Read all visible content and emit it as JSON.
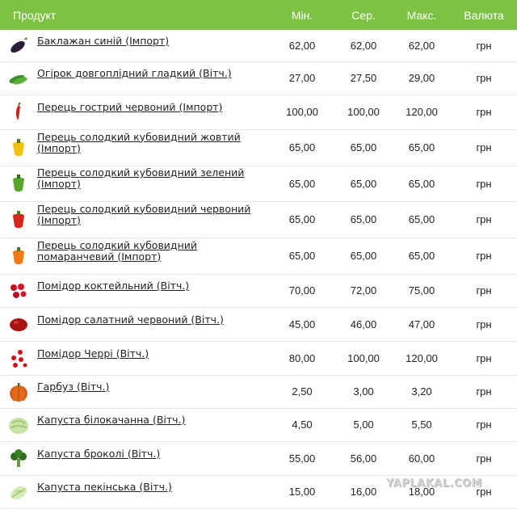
{
  "header": {
    "product": "Продукт",
    "min": "Мін.",
    "avg": "Сер.",
    "max": "Макс.",
    "currency": "Валюта"
  },
  "colors": {
    "header_bg": "#7dc242",
    "header_text": "#ffffff"
  },
  "rows": [
    {
      "icon": "eggplant-icon",
      "name": "Баклажан синій (Імпорт)",
      "min": "62,00",
      "avg": "62,00",
      "max": "62,00",
      "cur": "грн"
    },
    {
      "icon": "cucumber-icon",
      "name": "Огірок довгоплідний гладкий (Вітч.)",
      "min": "27,00",
      "avg": "27,50",
      "max": "29,00",
      "cur": "грн"
    },
    {
      "icon": "chili-pepper-icon",
      "name": "Перець гострий червоний (Імпорт)",
      "min": "100,00",
      "avg": "100,00",
      "max": "120,00",
      "cur": "грн"
    },
    {
      "icon": "yellow-pepper-icon",
      "name": "Перець солодкий кубовидний жовтий (Імпорт)",
      "min": "65,00",
      "avg": "65,00",
      "max": "65,00",
      "cur": "грн"
    },
    {
      "icon": "green-pepper-icon",
      "name": "Перець солодкий кубовидний зелений (Імпорт)",
      "min": "65,00",
      "avg": "65,00",
      "max": "65,00",
      "cur": "грн"
    },
    {
      "icon": "red-pepper-icon",
      "name": "Перець солодкий кубовидний червоний (Імпорт)",
      "min": "65,00",
      "avg": "65,00",
      "max": "65,00",
      "cur": "грн"
    },
    {
      "icon": "orange-pepper-icon",
      "name": "Перець солодкий кубовидний помаранчевий (Імпорт)",
      "min": "65,00",
      "avg": "65,00",
      "max": "65,00",
      "cur": "грн"
    },
    {
      "icon": "cocktail-tomato-icon",
      "name": "Помідор коктейльний (Вітч.)",
      "min": "70,00",
      "avg": "72,00",
      "max": "75,00",
      "cur": "грн"
    },
    {
      "icon": "salad-tomato-icon",
      "name": "Помідор салатний червоний (Вітч.)",
      "min": "45,00",
      "avg": "46,00",
      "max": "47,00",
      "cur": "грн"
    },
    {
      "icon": "cherry-tomato-icon",
      "name": "Помідор Черрі (Вітч.)",
      "min": "80,00",
      "avg": "100,00",
      "max": "120,00",
      "cur": "грн"
    },
    {
      "icon": "pumpkin-icon",
      "name": "Гарбуз (Вітч.)",
      "min": "2,50",
      "avg": "3,00",
      "max": "3,20",
      "cur": "грн"
    },
    {
      "icon": "white-cabbage-icon",
      "name": "Капуста білокачанна (Вітч.)",
      "min": "4,50",
      "avg": "5,00",
      "max": "5,50",
      "cur": "грн"
    },
    {
      "icon": "broccoli-icon",
      "name": "Капуста броколі (Вітч.)",
      "min": "55,00",
      "avg": "56,00",
      "max": "60,00",
      "cur": "грн"
    },
    {
      "icon": "chinese-cabbage-icon",
      "name": "Капуста пекінська (Вітч.)",
      "min": "15,00",
      "avg": "16,00",
      "max": "18,00",
      "cur": "грн"
    }
  ],
  "watermark": "YAPLAKAL.COM"
}
